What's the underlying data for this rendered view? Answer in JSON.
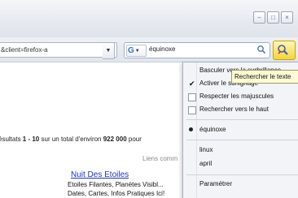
{
  "navbar": {
    "url_fragment": "&client=firefox-a",
    "search_value": "équinoxe"
  },
  "tooltip": "Rechercher le texte",
  "results": {
    "prefix": "ésultats ",
    "range": "1 - 10",
    "middle": " sur un total d'environ ",
    "count": "922 000",
    "suffix": " pour"
  },
  "ads": {
    "header": "Liens comm",
    "title": "Nuit Des Etoiles",
    "line1": "Etoiles Filantes, Planètes Visibl...",
    "line2": "Dates, Cartes, Infos Pratiques Ici!"
  },
  "menu": {
    "items": [
      {
        "label": "Basculer vers la surbrillance",
        "state": "none"
      },
      {
        "label": "Activer le surlignage",
        "state": "checked"
      },
      {
        "label": "Respecter les majuscules",
        "state": "unchecked"
      },
      {
        "label": "Rechercher vers le haut",
        "state": "unchecked"
      },
      {
        "label": "équinoxe",
        "state": "radio"
      },
      {
        "label": "linux",
        "state": "none"
      },
      {
        "label": "april",
        "state": "none"
      },
      {
        "label": "Paramétrer",
        "state": "none"
      }
    ]
  },
  "colors": {
    "highlight_button": "#f5d43a",
    "link": "#1a35c8",
    "tooltip_bg": "#fdfbd4"
  }
}
